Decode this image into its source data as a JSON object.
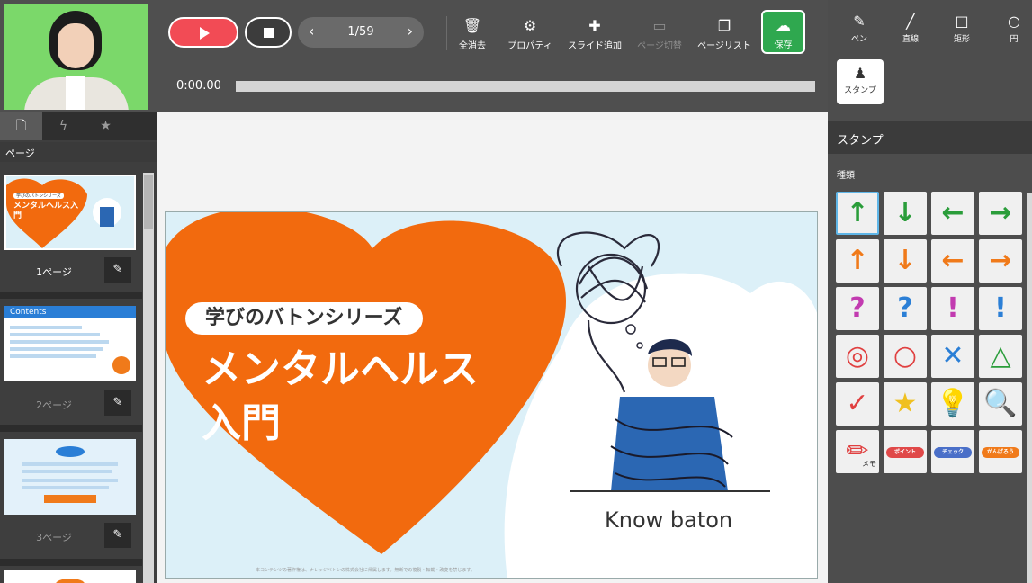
{
  "toolbar": {
    "pager": "1/59",
    "time": "0:00.00",
    "tools": [
      {
        "label": "全消去",
        "icon": "🗑"
      },
      {
        "label": "プロパティ",
        "icon": "⚙"
      },
      {
        "label": "スライド追加",
        "icon": "✚"
      },
      {
        "label": "ページ切替",
        "icon": "▭"
      },
      {
        "label": "ページリスト",
        "icon": "❐"
      }
    ],
    "save_label": "保存",
    "save_icon": "☁"
  },
  "left": {
    "header": "ページ",
    "pages": [
      {
        "label": "1ページ"
      },
      {
        "label": "2ページ"
      },
      {
        "label": "3ページ"
      }
    ],
    "thumb1_series": "学びのバトンシリーズ",
    "thumb1_title": "メンタルヘルス入門",
    "thumb2_title": "Contents"
  },
  "slide": {
    "series": "学びのバトンシリーズ",
    "title_line1": "メンタルヘルス",
    "title_line2": "入門",
    "logo": "Know baton",
    "footnote": "本コンテンツの著作権は、ナレッジバトンの株式会社に帰属します。無断での複製・転載・改変を禁じます。"
  },
  "right": {
    "tools": [
      {
        "label": "ペン",
        "icon": "✎"
      },
      {
        "label": "直線",
        "icon": "╱"
      },
      {
        "label": "矩形",
        "icon": "□"
      },
      {
        "label": "円",
        "icon": "○"
      }
    ],
    "stamp_label": "スタンプ",
    "stamp_icon": "♟",
    "section": "スタンプ",
    "sub": "種類",
    "stamps": [
      {
        "glyph": "↑",
        "color": "#2a9d3a"
      },
      {
        "glyph": "↓",
        "color": "#2a9d3a"
      },
      {
        "glyph": "←",
        "color": "#2a9d3a"
      },
      {
        "glyph": "→",
        "color": "#2a9d3a"
      },
      {
        "glyph": "↑",
        "color": "#f07a1a"
      },
      {
        "glyph": "↓",
        "color": "#f07a1a"
      },
      {
        "glyph": "←",
        "color": "#f07a1a"
      },
      {
        "glyph": "→",
        "color": "#f07a1a"
      },
      {
        "glyph": "?",
        "color": "#c23bb0"
      },
      {
        "glyph": "?",
        "color": "#2b7fd6"
      },
      {
        "glyph": "!",
        "color": "#c23bb0"
      },
      {
        "glyph": "!",
        "color": "#2b7fd6"
      },
      {
        "glyph": "◎",
        "color": "#e04040"
      },
      {
        "glyph": "○",
        "color": "#e04040"
      },
      {
        "glyph": "✕",
        "color": "#2b7fd6"
      },
      {
        "glyph": "△",
        "color": "#2a9d3a"
      },
      {
        "glyph": "✓",
        "color": "#e04040"
      },
      {
        "glyph": "★",
        "color": "#f0c020"
      },
      {
        "glyph": "💡",
        "color": "#f0c020"
      },
      {
        "glyph": "🔍",
        "color": "#333333"
      },
      {
        "glyph": "✏",
        "color": "#e04040",
        "sub": "メモ"
      }
    ],
    "pills": [
      {
        "label": "ポイント",
        "color": "#e04848"
      },
      {
        "label": "チェック",
        "color": "#4a6fc8"
      },
      {
        "label": "がんばろう",
        "color": "#f07a1a"
      }
    ]
  }
}
